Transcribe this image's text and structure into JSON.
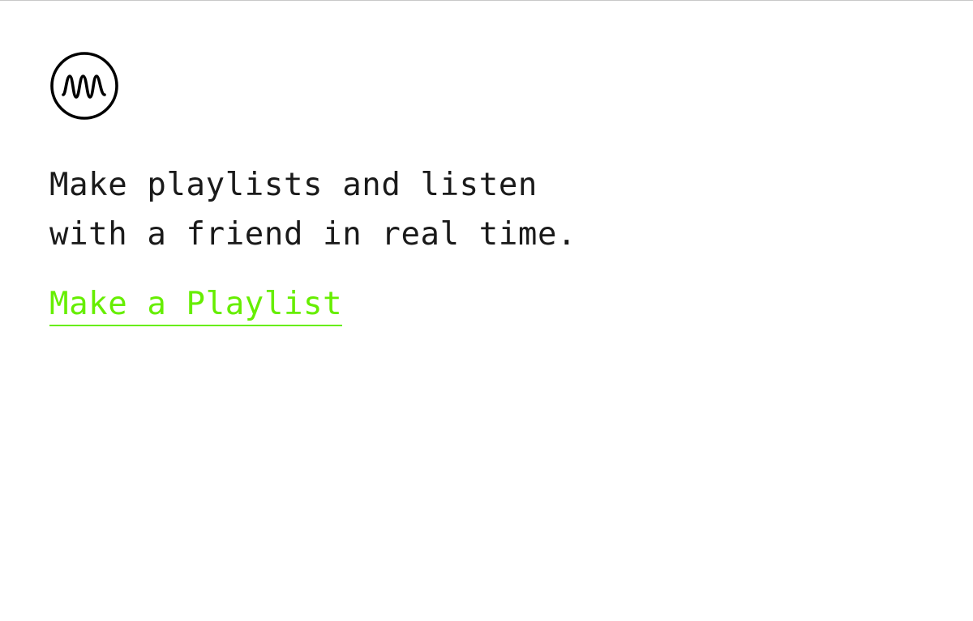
{
  "brand": {
    "logo_icon": "waveform-circle-icon",
    "accent_color": "#66ee00",
    "text_color": "#1a1a1a"
  },
  "hero": {
    "tagline_lines": [
      "Make playlists and listen",
      "with a friend in real time."
    ],
    "cta_label": "Make a Playlist"
  }
}
